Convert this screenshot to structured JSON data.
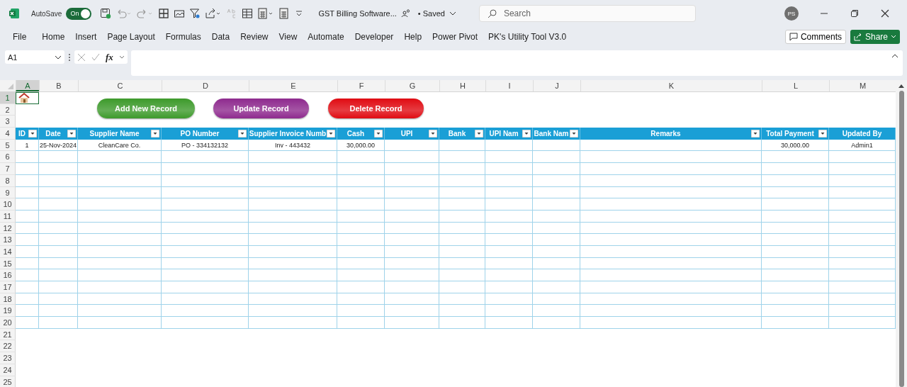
{
  "title_bar": {
    "autosave_label": "AutoSave",
    "autosave_on": true,
    "autosave_state": "On",
    "file_name": "GST Billing Software...",
    "save_status": "• Saved",
    "search_placeholder": "Search",
    "avatar": "PS"
  },
  "menu": [
    "File",
    "Home",
    "Insert",
    "Page Layout",
    "Formulas",
    "Data",
    "Review",
    "View",
    "Automate",
    "Developer",
    "Help",
    "Power Pivot",
    "PK's Utility Tool V3.0"
  ],
  "comments": "Comments",
  "share": "Share",
  "formula_bar": {
    "name_box": "A1",
    "fx": "fx"
  },
  "column_letters": [
    {
      "label": "A",
      "selected": true
    },
    {
      "label": "B",
      "selected": false
    },
    {
      "label": "C",
      "selected": false
    },
    {
      "label": "D",
      "selected": false
    },
    {
      "label": "E",
      "selected": false
    },
    {
      "label": "F",
      "selected": false
    },
    {
      "label": "G",
      "selected": false
    },
    {
      "label": "H",
      "selected": false
    },
    {
      "label": "I",
      "selected": false
    },
    {
      "label": "J",
      "selected": false
    },
    {
      "label": "K",
      "selected": false
    },
    {
      "label": "L",
      "selected": false
    },
    {
      "label": "M",
      "selected": false
    }
  ],
  "row_numbers": [
    {
      "label": "1",
      "selected": true
    },
    {
      "label": "2",
      "selected": false
    },
    {
      "label": "3",
      "selected": false
    },
    {
      "label": "4",
      "selected": false
    },
    {
      "label": "5",
      "selected": false
    },
    {
      "label": "6",
      "selected": false
    },
    {
      "label": "7",
      "selected": false
    },
    {
      "label": "8",
      "selected": false
    },
    {
      "label": "9",
      "selected": false
    },
    {
      "label": "10",
      "selected": false
    },
    {
      "label": "11",
      "selected": false
    },
    {
      "label": "12",
      "selected": false
    },
    {
      "label": "13",
      "selected": false
    },
    {
      "label": "14",
      "selected": false
    },
    {
      "label": "15",
      "selected": false
    },
    {
      "label": "16",
      "selected": false
    },
    {
      "label": "17",
      "selected": false
    },
    {
      "label": "18",
      "selected": false
    },
    {
      "label": "19",
      "selected": false
    },
    {
      "label": "20",
      "selected": false
    },
    {
      "label": "21",
      "selected": false
    },
    {
      "label": "22",
      "selected": false
    },
    {
      "label": "23",
      "selected": false
    },
    {
      "label": "24",
      "selected": false
    },
    {
      "label": "25",
      "selected": false
    }
  ],
  "buttons": [
    {
      "label": "Add New Record",
      "color": "#3d9a2b"
    },
    {
      "label": "Update Record",
      "color": "#8e2a8e"
    },
    {
      "label": "Delete Record",
      "color": "#e00b12"
    }
  ],
  "table": {
    "columns": [
      {
        "label": "ID",
        "filter": true
      },
      {
        "label": "Date",
        "filter": true
      },
      {
        "label": "Supplier Name",
        "filter": true
      },
      {
        "label": "PO Number",
        "filter": true
      },
      {
        "label": "Supplier Invoice Numb",
        "filter": true
      },
      {
        "label": "Cash",
        "filter": true
      },
      {
        "label": "UPI",
        "filter": true
      },
      {
        "label": "Bank",
        "filter": true
      },
      {
        "label": "UPI Nam",
        "filter": true
      },
      {
        "label": "Bank Nam",
        "filter": true
      },
      {
        "label": "Remarks",
        "filter": true
      },
      {
        "label": "Total Payment",
        "filter": true
      },
      {
        "label": "Updated By",
        "filter": false
      }
    ],
    "rows": [
      [
        "1",
        "25-Nov-2024",
        "CleanCare Co.",
        "PO - 334132132",
        "Inv - 443432",
        "30,000.00",
        "",
        "",
        "",
        "",
        "",
        "30,000.00",
        "Admin1"
      ]
    ]
  }
}
